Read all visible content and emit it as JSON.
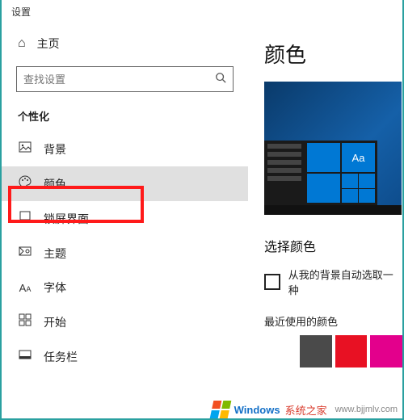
{
  "window": {
    "title": "设置"
  },
  "sidebar": {
    "home": "主页",
    "search_placeholder": "查找设置",
    "section": "个性化",
    "items": [
      {
        "label": "背景"
      },
      {
        "label": "颜色"
      },
      {
        "label": "锁屏界面"
      },
      {
        "label": "主题"
      },
      {
        "label": "字体"
      },
      {
        "label": "开始"
      },
      {
        "label": "任务栏"
      }
    ]
  },
  "content": {
    "heading": "颜色",
    "preview_tile_text": "Aa",
    "choose_color": "选择颜色",
    "auto_pick_label": "从我的背景自动选取一种",
    "recent_label": "最近使用的颜色",
    "swatches": [
      "#008b8b",
      "#4a4a4a",
      "#e81123",
      "#e3008c"
    ]
  },
  "watermark": {
    "brand": "Windows",
    "site_cn": "系统之家",
    "url": "www.bjjmlv.com"
  }
}
